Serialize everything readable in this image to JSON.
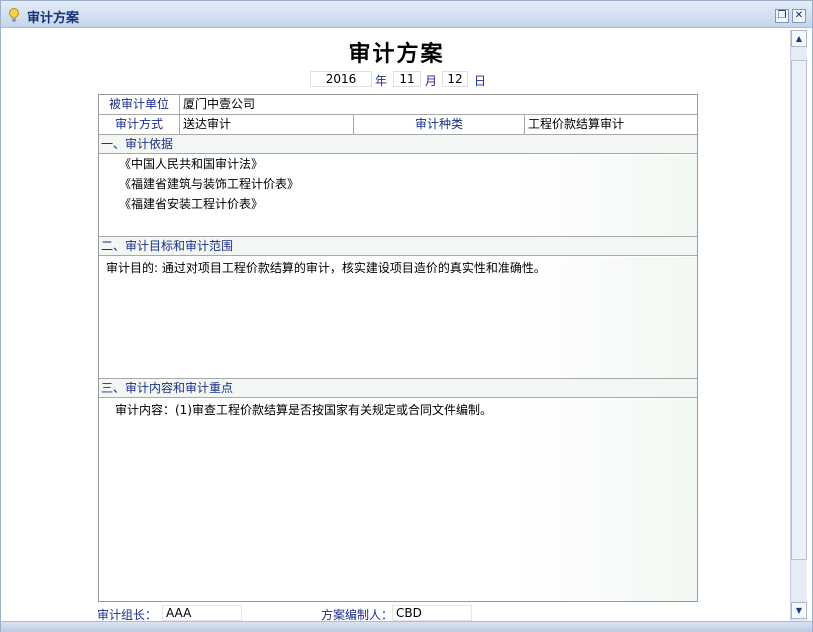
{
  "window": {
    "title": "审计方案",
    "restore_label": "❐",
    "close_label": "✕"
  },
  "document": {
    "title": "审计方案",
    "date": {
      "year": "2016",
      "year_unit": "年",
      "month": "11",
      "month_unit": "月",
      "day": "12",
      "day_unit": "日"
    }
  },
  "fields": {
    "audited_unit_label": "被审计单位",
    "audited_unit_value": "厦门中壹公司",
    "audit_method_label": "审计方式",
    "audit_method_value": "送达审计",
    "audit_type_label": "审计种类",
    "audit_type_value": "工程价款结算审计"
  },
  "sections": {
    "basis": {
      "heading": "一、审计依据",
      "lines": [
        "《中国人民共和国审计法》",
        "《福建省建筑与装饰工程计价表》",
        "《福建省安装工程计价表》"
      ]
    },
    "goals": {
      "heading": "二、审计目标和审计范围",
      "text": "审计目的: 通过对项目工程价款结算的审计，核实建设项目造价的真实性和准确性。"
    },
    "content": {
      "heading": "三、审计内容和审计重点",
      "text": "审计内容：(1)审查工程价款结算是否按国家有关规定或合同文件编制。"
    }
  },
  "footer": {
    "team_leader_label": "审计组长：",
    "team_leader_value": "AAA",
    "compiler_label": "方案编制人：",
    "compiler_value": "CBD"
  },
  "scrollbar": {
    "up_label": "▲",
    "down_label": "▼"
  }
}
